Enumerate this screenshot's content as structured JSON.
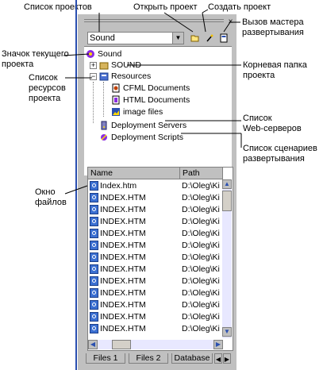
{
  "callouts": {
    "project_list": "Список проектов",
    "open_project": "Открыть проект",
    "create_project": "Создать проект",
    "deploy_wizard": "Вызов мастера\nразвертывания",
    "current_project_icon": "Значок текущего\nпроекта",
    "root_folder": "Корневая папка\nпроекта",
    "resources_list": "Список\nресурсов\nпроекта",
    "servers_list": "Список\nWeb-серверов",
    "scripts_list": "Список сценариев\nразвертывания",
    "files_window": "Окно\nфайлов"
  },
  "toolbar": {
    "project_combo_value": "Sound",
    "close_label": "×"
  },
  "tree": {
    "root": "Sound",
    "folder": "SOUND",
    "resources": "Resources",
    "cfml": "CFML Documents",
    "html": "HTML Documents",
    "images": "image files",
    "servers": "Deployment Servers",
    "scripts": "Deployment Scripts"
  },
  "files": {
    "col_name": "Name",
    "col_path": "Path",
    "rows": [
      {
        "name": "Index.htm",
        "path": "D:\\Oleg\\Ki"
      },
      {
        "name": "INDEX.HTM",
        "path": "D:\\Oleg\\Ki"
      },
      {
        "name": "INDEX.HTM",
        "path": "D:\\Oleg\\Ki"
      },
      {
        "name": "INDEX.HTM",
        "path": "D:\\Oleg\\Ki"
      },
      {
        "name": "INDEX.HTM",
        "path": "D:\\Oleg\\Ki"
      },
      {
        "name": "INDEX.HTM",
        "path": "D:\\Oleg\\Ki"
      },
      {
        "name": "INDEX.HTM",
        "path": "D:\\Oleg\\Ki"
      },
      {
        "name": "INDEX.HTM",
        "path": "D:\\Oleg\\Ki"
      },
      {
        "name": "INDEX.HTM",
        "path": "D:\\Oleg\\Ki"
      },
      {
        "name": "INDEX.HTM",
        "path": "D:\\Oleg\\Ki"
      },
      {
        "name": "INDEX.HTM",
        "path": "D:\\Oleg\\Ki"
      },
      {
        "name": "INDEX.HTM",
        "path": "D:\\Oleg\\Ki"
      },
      {
        "name": "INDEX.HTM",
        "path": "D:\\Oleg\\Ki"
      }
    ]
  },
  "tabs": [
    "Files 1",
    "Files 2",
    "Database"
  ],
  "icons": {
    "open": "folder-open-icon",
    "create": "magic-wand-icon",
    "deploy": "deploy-wizard-icon"
  }
}
